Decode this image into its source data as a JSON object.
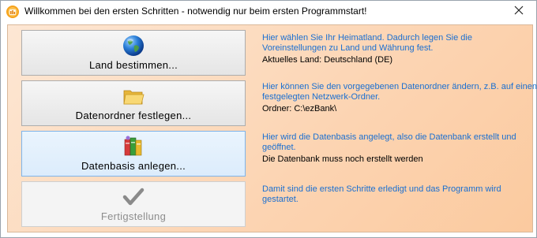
{
  "window": {
    "title": "Willkommen bei den ersten Schritten - notwendig nur beim ersten Programmstart!"
  },
  "steps": [
    {
      "button_label": "Land bestimmen...",
      "icon": "globe-icon",
      "description": "Hier wählen Sie Ihr Heimatland. Dadurch legen Sie die Voreinstellungen zu Land und Währung fest.",
      "status": "Aktuelles Land: Deutschland (DE)"
    },
    {
      "button_label": "Datenordner festlegen...",
      "icon": "folder-icon",
      "description": "Hier können Sie den vorgegebenen Datenordner ändern, z.B. auf einen festgelegten Netzwerk-Ordner.",
      "status": "Ordner: C:\\ezBank\\"
    },
    {
      "button_label": "Datenbasis anlegen...",
      "icon": "database-books-icon",
      "description": "Hier wird die Datenbasis angelegt, also die Datenbank erstellt und geöffnet.",
      "status": "Die Datenbank muss noch erstellt werden"
    },
    {
      "button_label": "Fertigstellung",
      "icon": "checkmark-icon",
      "description": "Damit sind die ersten Schritte erledigt und das Programm wird gestartet.",
      "status": ""
    }
  ],
  "colors": {
    "description_text": "#1a6fd1",
    "panel_gradient_start": "#fde7d4",
    "panel_gradient_end": "#fbca9f",
    "button_hover_border": "#7eb4ea"
  }
}
